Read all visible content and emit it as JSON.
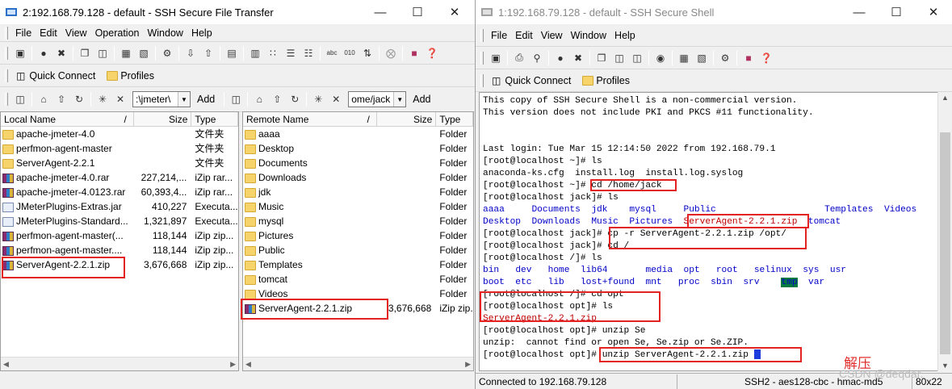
{
  "ft": {
    "title": "2:192.168.79.128 - default - SSH Secure File Transfer",
    "menus": [
      "File",
      "Edit",
      "View",
      "Operation",
      "Window",
      "Help"
    ],
    "quick_connect": "Quick Connect",
    "profiles": "Profiles",
    "local_path": ":\\jmeter\\",
    "remote_path": "ome/jack",
    "add_label": "Add",
    "local_headers": {
      "name": "Local Name",
      "sort": "/",
      "size": "Size",
      "type": "Type"
    },
    "remote_headers": {
      "name": "Remote Name",
      "sort": "/",
      "size": "Size",
      "type": "Type"
    },
    "local_files": [
      {
        "name": "apache-jmeter-4.0",
        "size": "",
        "type": "文件夹",
        "icon": "folder"
      },
      {
        "name": "perfmon-agent-master",
        "size": "",
        "type": "文件夹",
        "icon": "folder"
      },
      {
        "name": "ServerAgent-2.2.1",
        "size": "",
        "type": "文件夹",
        "icon": "folder"
      },
      {
        "name": "apache-jmeter-4.0.rar",
        "size": "227,214,...",
        "type": "iZip rar...",
        "icon": "zip"
      },
      {
        "name": "apache-jmeter-4.0123.rar",
        "size": "60,393,4...",
        "type": "iZip rar...",
        "icon": "zip"
      },
      {
        "name": "JMeterPlugins-Extras.jar",
        "size": "410,227",
        "type": "Executa...",
        "icon": "jar"
      },
      {
        "name": "JMeterPlugins-Standard...",
        "size": "1,321,897",
        "type": "Executa...",
        "icon": "jar"
      },
      {
        "name": "perfmon-agent-master(...",
        "size": "118,144",
        "type": "iZip zip...",
        "icon": "zip"
      },
      {
        "name": "perfmon-agent-master....",
        "size": "118,144",
        "type": "iZip zip...",
        "icon": "zip"
      },
      {
        "name": "ServerAgent-2.2.1.zip",
        "size": "3,676,668",
        "type": "iZip zip...",
        "icon": "zip"
      }
    ],
    "remote_files": [
      {
        "name": "aaaa",
        "size": "",
        "type": "Folder",
        "icon": "folder"
      },
      {
        "name": "Desktop",
        "size": "",
        "type": "Folder",
        "icon": "folder"
      },
      {
        "name": "Documents",
        "size": "",
        "type": "Folder",
        "icon": "folder"
      },
      {
        "name": "Downloads",
        "size": "",
        "type": "Folder",
        "icon": "folder"
      },
      {
        "name": "jdk",
        "size": "",
        "type": "Folder",
        "icon": "folder"
      },
      {
        "name": "Music",
        "size": "",
        "type": "Folder",
        "icon": "folder"
      },
      {
        "name": "mysql",
        "size": "",
        "type": "Folder",
        "icon": "folder"
      },
      {
        "name": "Pictures",
        "size": "",
        "type": "Folder",
        "icon": "folder"
      },
      {
        "name": "Public",
        "size": "",
        "type": "Folder",
        "icon": "folder"
      },
      {
        "name": "Templates",
        "size": "",
        "type": "Folder",
        "icon": "folder"
      },
      {
        "name": "tomcat",
        "size": "",
        "type": "Folder",
        "icon": "folder"
      },
      {
        "name": "Videos",
        "size": "",
        "type": "Folder",
        "icon": "folder"
      },
      {
        "name": "ServerAgent-2.2.1.zip",
        "size": "3,676,668",
        "type": "iZip zip...",
        "icon": "zip"
      }
    ]
  },
  "sh": {
    "title": "1:192.168.79.128 - default - SSH Secure Shell",
    "menus": [
      "File",
      "Edit",
      "View",
      "Window",
      "Help"
    ],
    "quick_connect": "Quick Connect",
    "profiles": "Profiles",
    "lines": {
      "l1": "This copy of SSH Secure Shell is a non-commercial version.",
      "l2": "This version does not include PKI and PKCS #11 functionality.",
      "l3": "",
      "l4": "",
      "l5": "Last login: Tue Mar 15 12:14:50 2022 from 192.168.79.1",
      "l6": "[root@localhost ~]# ls",
      "l7": "anaconda-ks.cfg  install.log  install.log.syslog",
      "l8": "[root@localhost ~]# cd /home/jack",
      "l9": "[root@localhost jack]# ls",
      "l12": "[root@localhost jack]# cp -r ServerAgent-2.2.1.zip /opt/",
      "l13": "[root@localhost jack]# cd /",
      "l14": "[root@localhost /]# ls",
      "l17": "[root@localhost /]# cd opt",
      "l18": "[root@localhost opt]# ls",
      "l19": "ServerAgent-2.2.1.zip",
      "l20": "[root@localhost opt]# unzip Se",
      "l21": "unzip:  cannot find or open Se, Se.zip or Se.ZIP.",
      "l22_prompt": "[root@localhost opt]# ",
      "l22_cmd": "unzip ServerAgent-2.2.1.zip "
    },
    "ls_jack_row1": [
      "aaaa",
      "Documents",
      "jdk",
      "mysql",
      "Public",
      "Templates",
      "Videos"
    ],
    "ls_jack_row2": [
      "Desktop",
      "Downloads",
      "Music",
      "Pictures",
      "ServerAgent-2.2.1.zip",
      "tomcat"
    ],
    "ls_root_row1": [
      "bin",
      "dev",
      "home",
      "lib64",
      "media",
      "opt",
      "root",
      "selinux",
      "sys",
      "usr"
    ],
    "ls_root_row2": [
      "boot",
      "etc",
      "lib",
      "lost+found",
      "mnt",
      "proc",
      "sbin",
      "srv",
      "tmp",
      "var"
    ],
    "status_connected": "Connected to 192.168.79.128",
    "status_cipher": "SSH2 - aes128-cbc - hmac-md5",
    "status_size": "80x22",
    "annotation": "解压",
    "watermark": "CSDN @deqdar."
  }
}
